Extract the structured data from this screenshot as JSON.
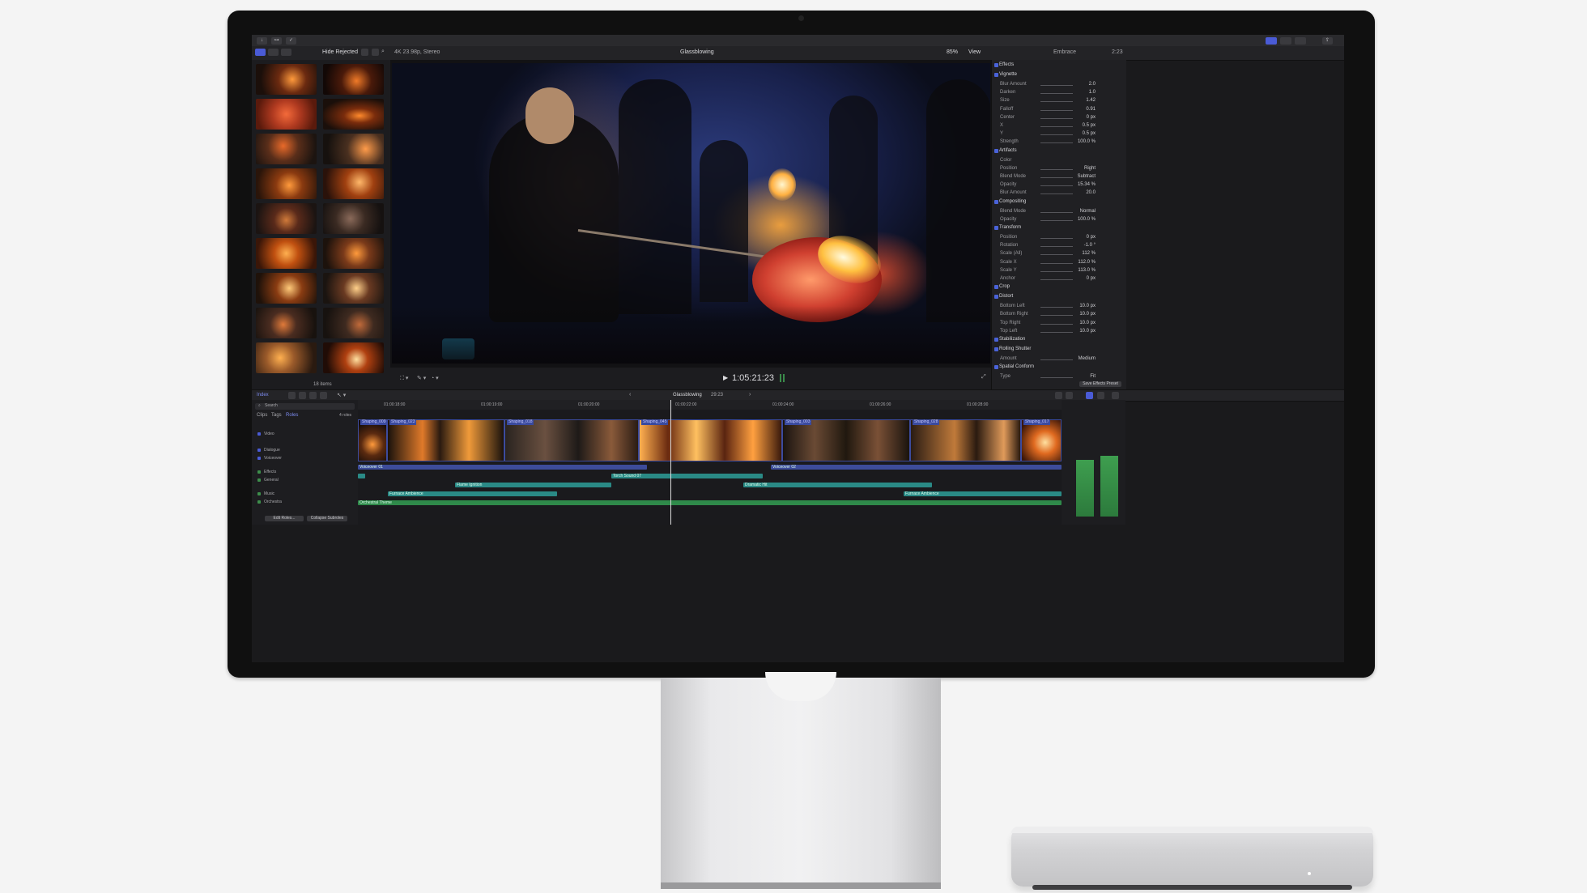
{
  "toolbar": {
    "browser_filter": "Hide Rejected",
    "format_info": "4K 23.98p, Stereo",
    "viewer_title": "Glassblowing",
    "zoom": "85%",
    "view_menu": "View",
    "inspector_title": "Embrace",
    "inspector_time": "2:23"
  },
  "browser": {
    "item_count": "18 items"
  },
  "viewer": {
    "timecode": "1:05:21:23"
  },
  "inspector": {
    "rows": [
      {
        "k": "Effects",
        "v": "",
        "sec": true
      },
      {
        "k": "Vignette",
        "v": "",
        "sec": true
      },
      {
        "k": "Blur Amount",
        "v": "2.0"
      },
      {
        "k": "Darken",
        "v": "1.0"
      },
      {
        "k": "Size",
        "v": "1.42"
      },
      {
        "k": "Falloff",
        "v": "0.91"
      },
      {
        "k": "Center",
        "v": "0 px"
      },
      {
        "k": "X",
        "v": "0.5 px"
      },
      {
        "k": "Y",
        "v": "0.5 px"
      },
      {
        "k": "Strength",
        "v": "100.0 %"
      },
      {
        "k": "Artifacts",
        "v": "",
        "sec": true
      },
      {
        "k": "Color",
        "v": ""
      },
      {
        "k": "Position",
        "v": "Right"
      },
      {
        "k": "Blend Mode",
        "v": "Subtract"
      },
      {
        "k": "Opacity",
        "v": "15.34 %"
      },
      {
        "k": "Blur Amount",
        "v": "20.0"
      },
      {
        "k": "Compositing",
        "v": "",
        "sec": true
      },
      {
        "k": "Blend Mode",
        "v": "Normal"
      },
      {
        "k": "Opacity",
        "v": "100.0 %"
      },
      {
        "k": "Transform",
        "v": "",
        "sec": true
      },
      {
        "k": "Position",
        "v": "0 px"
      },
      {
        "k": "Rotation",
        "v": "-1.0 °"
      },
      {
        "k": "Scale (All)",
        "v": "112 %"
      },
      {
        "k": "Scale X",
        "v": "112.0 %"
      },
      {
        "k": "Scale Y",
        "v": "113.0 %"
      },
      {
        "k": "Anchor",
        "v": "0 px"
      },
      {
        "k": "Crop",
        "v": "",
        "sec": true
      },
      {
        "k": "Distort",
        "v": "",
        "sec": true
      },
      {
        "k": "Bottom Left",
        "v": "10.0 px"
      },
      {
        "k": "Bottom Right",
        "v": "10.0 px"
      },
      {
        "k": "Top Right",
        "v": "10.0 px"
      },
      {
        "k": "Top Left",
        "v": "10.0 px"
      },
      {
        "k": "Stabilization",
        "v": "",
        "sec": true
      },
      {
        "k": "Rolling Shutter",
        "v": "",
        "sec": true
      },
      {
        "k": "Amount",
        "v": "Medium"
      },
      {
        "k": "Spatial Conform",
        "v": "",
        "sec": true
      },
      {
        "k": "Type",
        "v": "Fit"
      }
    ],
    "save_preset": "Save Effects Preset"
  },
  "timeline": {
    "index_label": "Index",
    "project": "Glassblowing",
    "duration": "29:23",
    "ruler": [
      "01:00:18:00",
      "01:00:19:00",
      "01:00:20:00",
      "01:00:22:00",
      "01:00:24:00",
      "01:00:26:00",
      "01:00:28:00"
    ],
    "video_clips": [
      "Shaping_009",
      "Shaping_023",
      "Shaping_018",
      "Shaping_045",
      "Shaping_003",
      "Shaping_028",
      "Shaping_017"
    ],
    "audio_clips": {
      "vo1": "Voiceover 01",
      "vo2": "Voiceover 02",
      "torch": "Torch Sound 07",
      "flame": "Flame Ignition",
      "dramatic": "Dramatic Hit",
      "amb1": "Furnace Ambience",
      "amb2": "Furnace Ambience",
      "theme": "Orchestral Theme"
    }
  },
  "index": {
    "search_placeholder": "Search",
    "tabs": [
      "Clips",
      "Tags",
      "Roles"
    ],
    "roles_count": "4 roles",
    "roles": [
      "Video",
      "Dialogue",
      "Voiceover",
      "Effects",
      "General",
      "Music",
      "Orchestra"
    ],
    "edit_roles": "Edit Roles...",
    "collapse": "Collapse Subroles"
  },
  "colors": {
    "accent": "#4a5bd6",
    "audio_green": "#2f8a4a",
    "audio_teal": "#2a8a86",
    "video_blue": "#3c4b9e"
  }
}
